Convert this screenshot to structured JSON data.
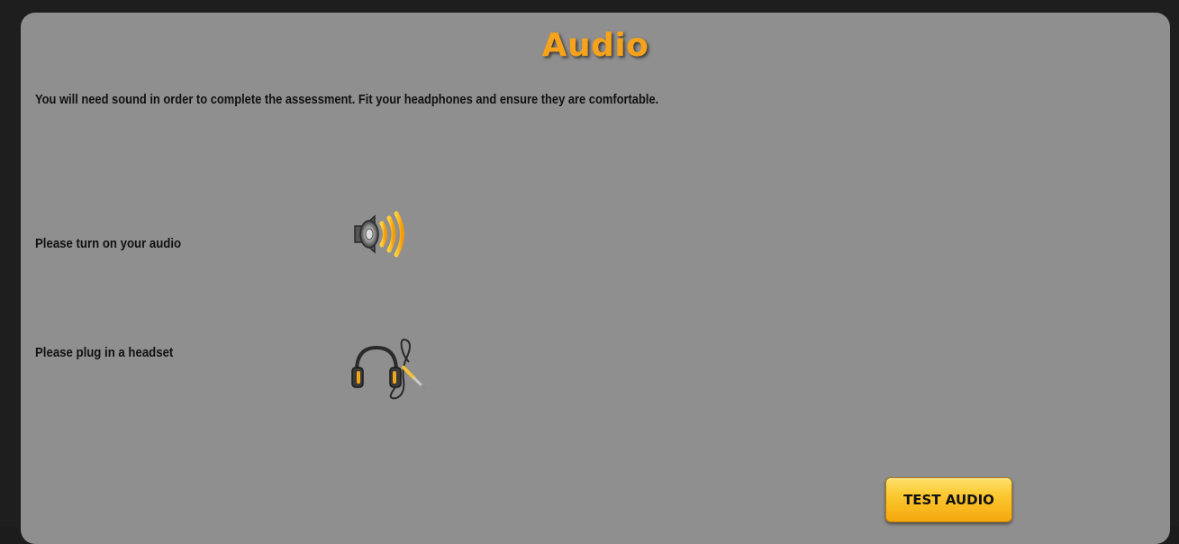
{
  "page": {
    "title": "Audio",
    "intro": "You will need sound in order to complete the assessment. Fit your headphones and ensure they are comfortable."
  },
  "checks": {
    "audio_label": "Please turn on your audio",
    "audio_icon": "speaker-icon",
    "headset_label": "Please plug in a headset",
    "headset_icon": "headset-icon"
  },
  "actions": {
    "test_audio_label": "TEST AUDIO"
  },
  "colors": {
    "accent": "#f7a21b",
    "panel": "#8f8f8f",
    "frame": "#1e1e1e"
  }
}
